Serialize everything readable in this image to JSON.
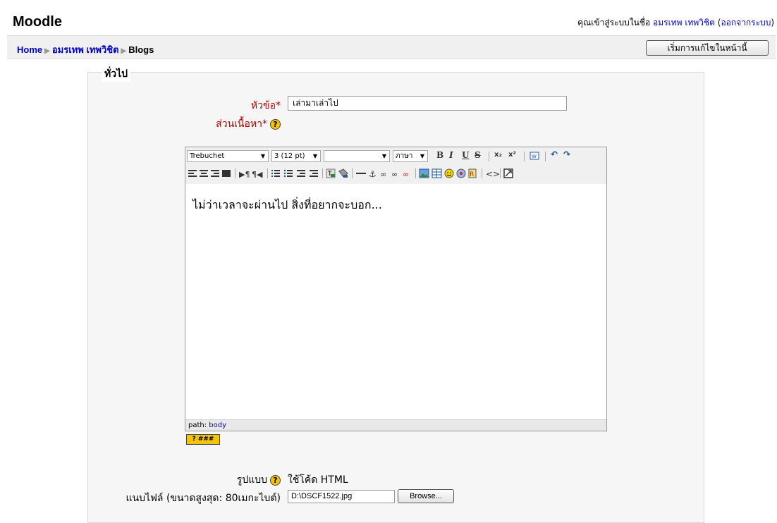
{
  "header": {
    "site_name": "Moodle",
    "login_text": "คุณเข้าสู่ระบบในชื่อ",
    "user_name": "อมรเทพ เทพวิชิต",
    "logout_label": "ออกจากระบบ"
  },
  "breadcrumb": {
    "items": [
      "Home",
      "อมรเทพ เทพวิชิต",
      "Blogs"
    ]
  },
  "edit_button_label": "เริ่มการแก้ไขในหน้านี้",
  "form": {
    "legend": "ทั่วไป",
    "subject_label": "หัวข้อ",
    "subject_value": "เล่ามาเล่าไป",
    "body_label": "ส่วนเนื้อหา",
    "required_marker": "*",
    "help_glyph": "?",
    "format_label": "รูปแบบ",
    "format_value": "ใช้โค้ด HTML",
    "attachment_label": "แนบไฟล์ (ขนาดสูงสุด: 80เมกะไบต์)",
    "attachment_value": "D:\\DSCF1522.jpg",
    "browse_label": "Browse..."
  },
  "editor": {
    "font_family": "Trebuchet",
    "font_size": "3 (12 pt)",
    "style_value": "",
    "language_label": "ภาษา",
    "toolbar_row1": [
      "B",
      "I",
      "U",
      "S",
      "x₂",
      "x²",
      "↶",
      "↷"
    ],
    "content": "ไม่ว่าเวลาจะผ่านไป สิ่งที่อยากจะบอก...",
    "path_label": "path:",
    "path_value": "body",
    "keyboard_help": "? ###"
  }
}
